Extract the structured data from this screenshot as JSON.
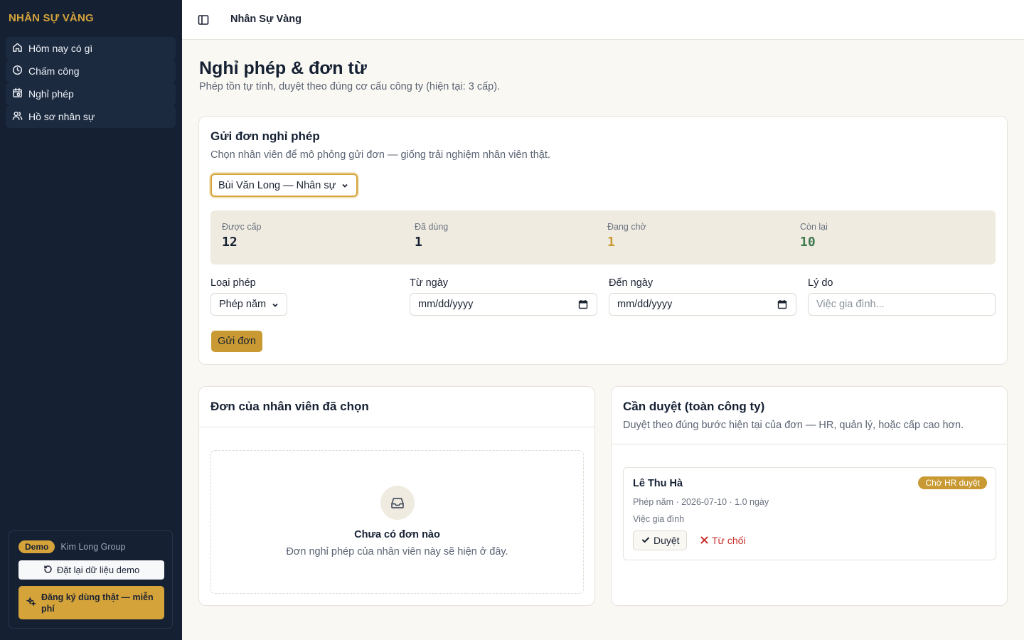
{
  "sidebar": {
    "brand": "NHÂN SỰ VÀNG",
    "items": [
      {
        "label": "Hôm nay có gì",
        "icon": "home-icon"
      },
      {
        "label": "Chấm công",
        "icon": "clock-icon"
      },
      {
        "label": "Nghỉ phép",
        "icon": "calendar-icon"
      },
      {
        "label": "Hồ sơ nhân sự",
        "icon": "users-icon"
      }
    ],
    "demo_badge": "Demo",
    "org_name": "Kim Long Group",
    "reset_label": "Đặt lại dữ liệu demo",
    "signup_label": "Đăng ký dùng thật — miễn phí"
  },
  "topbar": {
    "title": "Nhân Sự Vàng"
  },
  "page": {
    "title": "Nghỉ phép & đơn từ",
    "subtitle": "Phép tồn tự tính, duyệt theo đúng cơ cấu công ty (hiện tại: 3 cấp)."
  },
  "form_card": {
    "title": "Gửi đơn nghỉ phép",
    "subtitle": "Chọn nhân viên để mô phỏng gửi đơn — giống trải nghiệm nhân viên thật.",
    "employee_selected": "Bùi Văn Long — Nhân sự",
    "stats": [
      {
        "label": "Được cấp",
        "value": "12",
        "color": "#152033"
      },
      {
        "label": "Đã dùng",
        "value": "1",
        "color": "#152033"
      },
      {
        "label": "Đang chờ",
        "value": "1",
        "color": "#c99a33"
      },
      {
        "label": "Còn lại",
        "value": "10",
        "color": "#3f7a4f"
      }
    ],
    "fields": {
      "type_label": "Loại phép",
      "type_value": "Phép năm",
      "from_label": "Từ ngày",
      "from_value": "mm/dd/yyyy",
      "to_label": "Đến ngày",
      "to_value": "mm/dd/yyyy",
      "reason_label": "Lý do",
      "reason_placeholder": "Việc gia đình..."
    },
    "submit_label": "Gửi đơn"
  },
  "employee_card": {
    "title": "Đơn của nhân viên đã chọn",
    "empty_title": "Chưa có đơn nào",
    "empty_sub": "Đơn nghỉ phép của nhân viên này sẽ hiện ở đây."
  },
  "approve_card": {
    "title": "Cần duyệt (toàn công ty)",
    "subtitle": "Duyệt theo đúng bước hiện tại của đơn — HR, quản lý, hoặc cấp cao hơn.",
    "request": {
      "name": "Lê Thu Hà",
      "status": "Chờ HR duyệt",
      "meta": "Phép năm · 2026-07-10 · 1.0 ngày",
      "reason": "Việc gia đình",
      "approve_label": "Duyệt",
      "reject_label": "Từ chối"
    }
  }
}
